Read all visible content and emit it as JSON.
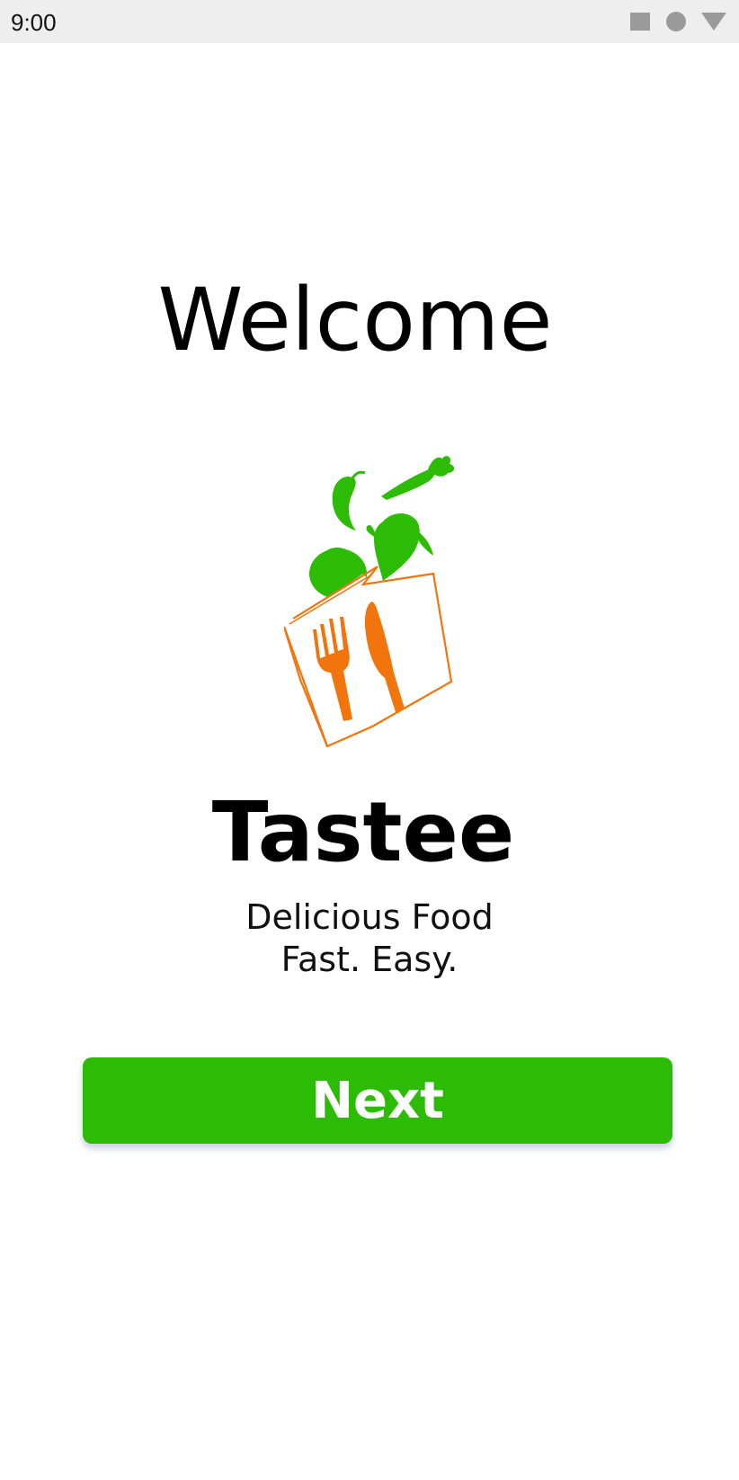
{
  "status_bar": {
    "time": "9:00",
    "icons": [
      "square-icon",
      "circle-icon",
      "triangle-down-icon"
    ]
  },
  "welcome": {
    "title": "Welcome"
  },
  "brand": {
    "name": "Tastee",
    "tagline_line1": "Delicious Food",
    "tagline_line2": "Fast. Easy."
  },
  "actions": {
    "next_label": "Next"
  },
  "colors": {
    "accent_green": "#2dbc05",
    "logo_orange": "#f2740c",
    "status_bar_bg": "#eeeeee"
  }
}
